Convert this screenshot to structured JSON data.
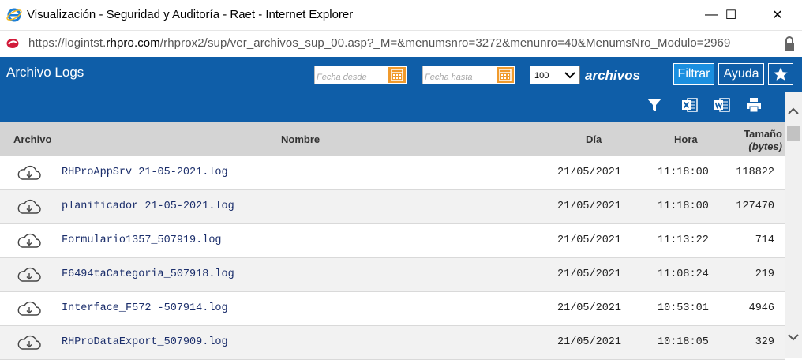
{
  "window": {
    "title": "Visualización - Seguridad y Auditoría - Raet - Internet Explorer",
    "minimize": "—",
    "maximize": "☐",
    "close": "✕"
  },
  "address": {
    "url_prefix": "https://logintst.",
    "url_domain": "rhpro.com",
    "url_path": "/rhprox2/sup/ver_archivos_sup_00.asp?_M=&menumsnro=3272&menunro=40&MenumsNro_Modulo=2969"
  },
  "header": {
    "title": "Archivo Logs",
    "fecha_desde_placeholder": "Fecha desde",
    "fecha_hasta_placeholder": "Fecha hasta",
    "page_size": "100",
    "archivos_label": "archivos",
    "filtrar_label": "Filtrar",
    "ayuda_label": "Ayuda"
  },
  "colors": {
    "header_bg": "#0f5ea8",
    "calendar": "#f09a2c",
    "filtrar_bg": "#1a8fe0"
  },
  "icons": [
    "ie-icon",
    "site-icon",
    "lock-icon",
    "calendar-icon",
    "chevron-down-icon",
    "star-icon",
    "filter-icon",
    "excel-icon",
    "word-icon",
    "print-icon",
    "cloud-download-icon"
  ],
  "table": {
    "headers": {
      "archivo": "Archivo",
      "nombre": "Nombre",
      "dia": "Día",
      "hora": "Hora",
      "tamano": "Tamaño",
      "tamano_unit": "(bytes)"
    },
    "rows": [
      {
        "name": "RHProAppSrv 21-05-2021.log",
        "dia": "21/05/2021",
        "hora": "11:18:00",
        "size": "118822"
      },
      {
        "name": "planificador 21-05-2021.log",
        "dia": "21/05/2021",
        "hora": "11:18:00",
        "size": "127470"
      },
      {
        "name": "Formulario1357_507919.log",
        "dia": "21/05/2021",
        "hora": "11:13:22",
        "size": "714"
      },
      {
        "name": "F6494taCategoria_507918.log",
        "dia": "21/05/2021",
        "hora": "11:08:24",
        "size": "219"
      },
      {
        "name": "Interface_F572 -507914.log",
        "dia": "21/05/2021",
        "hora": "10:53:01",
        "size": "4946"
      },
      {
        "name": "RHProDataExport_507909.log",
        "dia": "21/05/2021",
        "hora": "10:18:05",
        "size": "329"
      }
    ]
  }
}
